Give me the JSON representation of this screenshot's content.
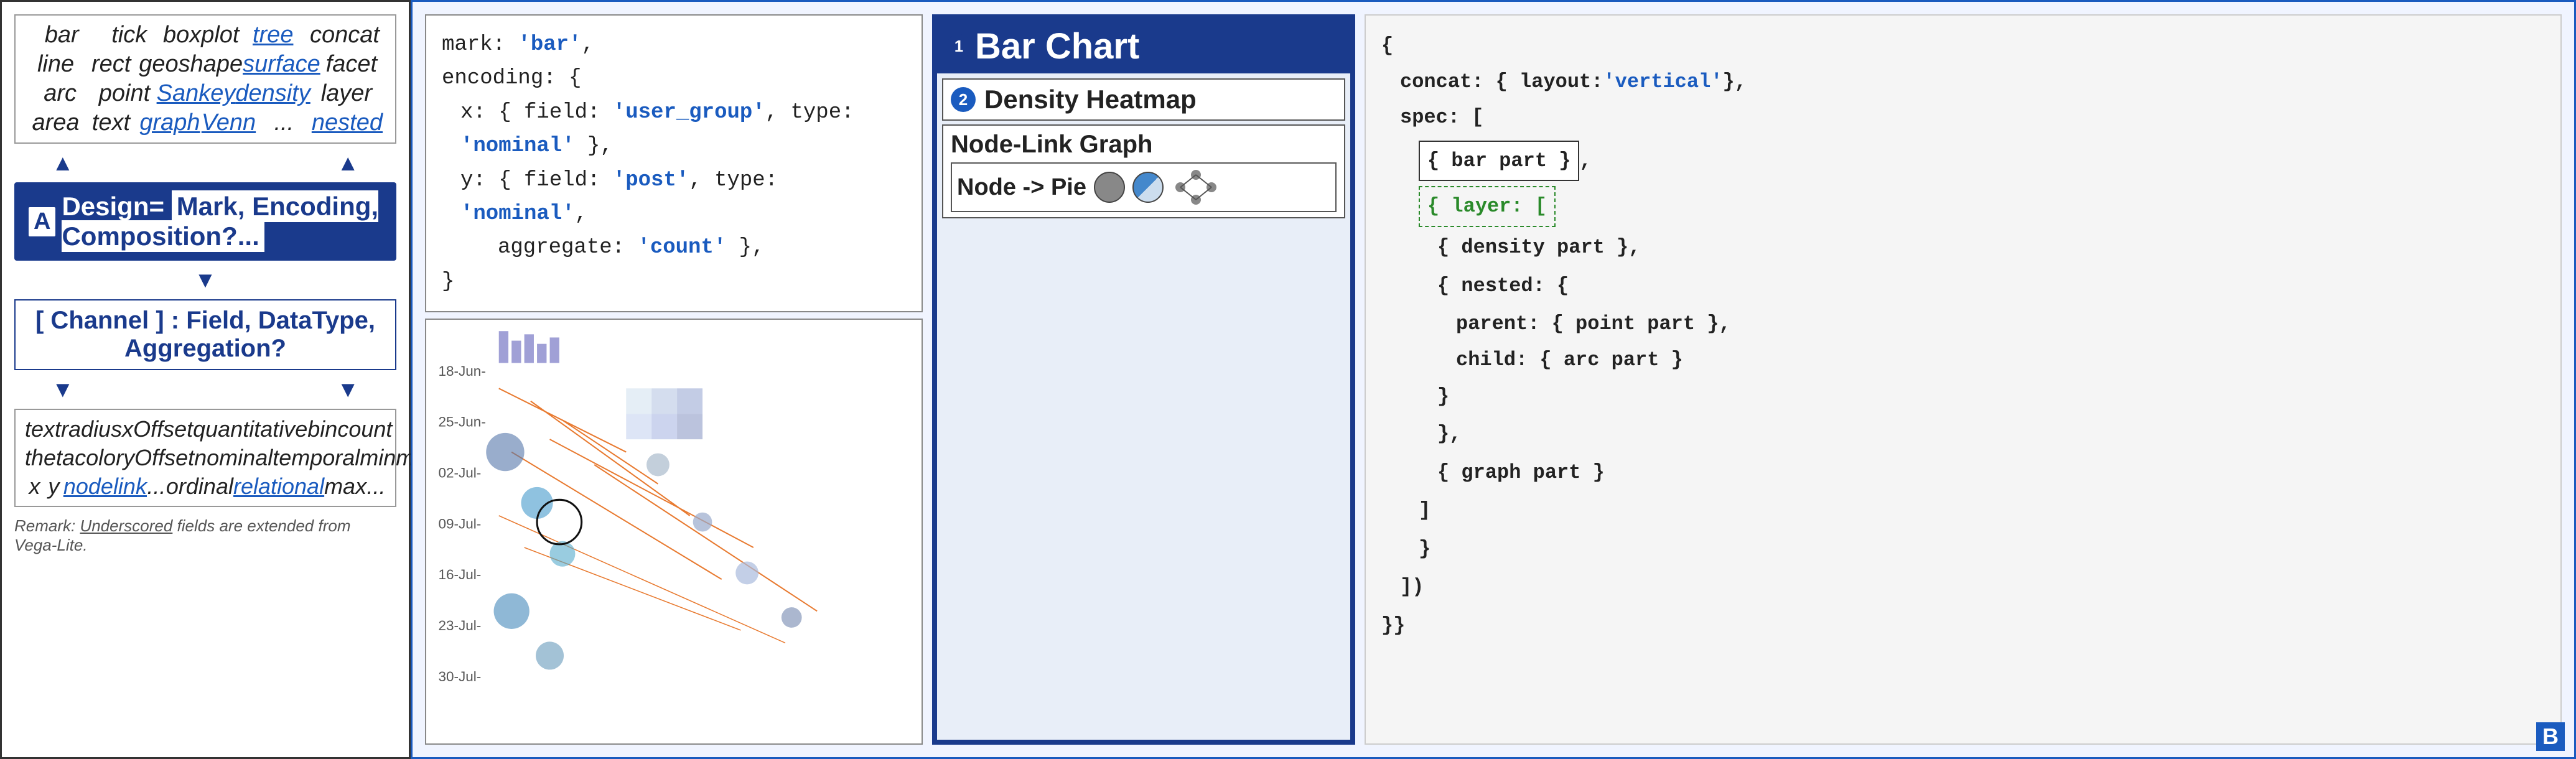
{
  "left": {
    "marks": {
      "rows": [
        [
          "bar",
          "tick",
          "boxplot",
          "tree",
          "concat"
        ],
        [
          "line",
          "rect",
          "geoshape",
          "surface",
          "facet"
        ],
        [
          "arc",
          "point",
          "Sankey",
          "density",
          "layer"
        ],
        [
          "area",
          "text",
          "graph",
          "Venn",
          "...",
          "nested"
        ]
      ],
      "links": [
        "tree",
        "surface",
        "Sankey",
        "density",
        "graph",
        "Venn",
        "nested"
      ]
    },
    "design_label_a": "A",
    "design_text": "Design= Mark, Encoding, Composition?...",
    "channel_text": "[ Channel ] : Field, DataType, Aggregation?",
    "encoding_rows": [
      [
        "text",
        "radius",
        "xOffset",
        "quantitative",
        "bin",
        "count"
      ],
      [
        "theta",
        "color",
        "yOffset",
        "nominal",
        "temporal",
        "min",
        "mean"
      ],
      [
        "x",
        "y",
        "node",
        "link",
        "...",
        "ordinal",
        "relational",
        "max",
        "..."
      ]
    ],
    "encoding_links": [
      "node",
      "link",
      "relational"
    ],
    "remark": "Remark: Underscored fields are extended from Vega-Lite."
  },
  "right": {
    "code": {
      "lines": [
        "mark: 'bar',",
        "encoding: {",
        "  x: { field: 'user_group', type: 'nominal' },",
        "  y: { field: 'post', type: 'nominal',",
        "       aggregate: 'count' },",
        "}"
      ],
      "strings": [
        "bar",
        "user_group",
        "nominal",
        "post",
        "nominal",
        "count"
      ]
    },
    "chart": {
      "title": "Bar Chart",
      "sublabels": [
        {
          "num": "2",
          "text": "Density Heatmap"
        },
        {
          "text": "Node-Link Graph"
        },
        {
          "text": "Node -> Pie"
        }
      ]
    },
    "composition": {
      "lines": [
        "{",
        "  concat: { layout: 'vertical' },",
        "  spec: [",
        "    { bar part },",
        "    { layer: [",
        "        { density part },",
        "        { nested: {",
        "            parent: { point part },",
        "            child: { arc part }",
        "          }",
        "        },",
        "        { graph part }",
        "      ]",
        "    }",
        "  ]",
        "}}"
      ]
    },
    "b_label": "B"
  }
}
